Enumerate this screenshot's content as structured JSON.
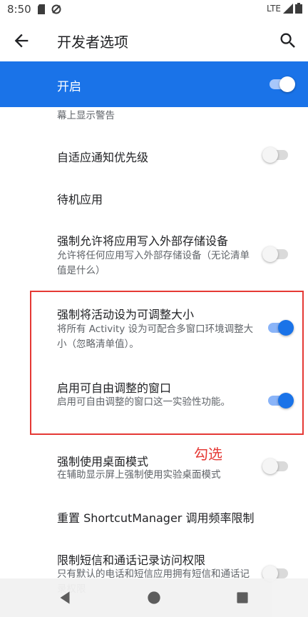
{
  "status_bar": {
    "time": "8:50",
    "network": "LTE"
  },
  "app_bar": {
    "title": "开发者选项",
    "back_icon": "arrow-back-icon",
    "search_icon": "search-icon"
  },
  "master": {
    "label": "开启",
    "enabled": true
  },
  "partial_top_text": "幕上显示警告",
  "rows": [
    {
      "title": "自适应通知优先级",
      "subtitle": "",
      "enabled": false
    },
    {
      "title": "待机应用",
      "subtitle": ""
    },
    {
      "title": "强制允许将应用写入外部存储设备",
      "subtitle": "允许将任何应用写入外部存储设备（无论清单值是什么）",
      "enabled": false
    },
    {
      "title": "强制将活动设为可调整大小",
      "subtitle": "将所有 Activity 设为可配合多窗口环境调整大小（忽略清单值）。",
      "enabled": true
    },
    {
      "title": "启用可自由调整的窗口",
      "subtitle": "启用可自由调整的窗口这一实验性功能。",
      "enabled": true
    },
    {
      "title": "强制使用桌面模式",
      "subtitle": "在辅助显示屏上强制使用实验桌面模式",
      "enabled": false
    },
    {
      "title": "重置 ShortcutManager 调用频率限制",
      "subtitle": ""
    },
    {
      "title": "限制短信和通话记录访问权限",
      "subtitle": "只有默认的电话和短信应用拥有短信和通话记录权限",
      "enabled": false
    }
  ],
  "annotation": "勾选",
  "colors": {
    "accent": "#1a73e8",
    "highlight": "#e53935"
  },
  "nav": {
    "back": "nav-back-icon",
    "home": "nav-home-icon",
    "recents": "nav-recents-icon"
  }
}
